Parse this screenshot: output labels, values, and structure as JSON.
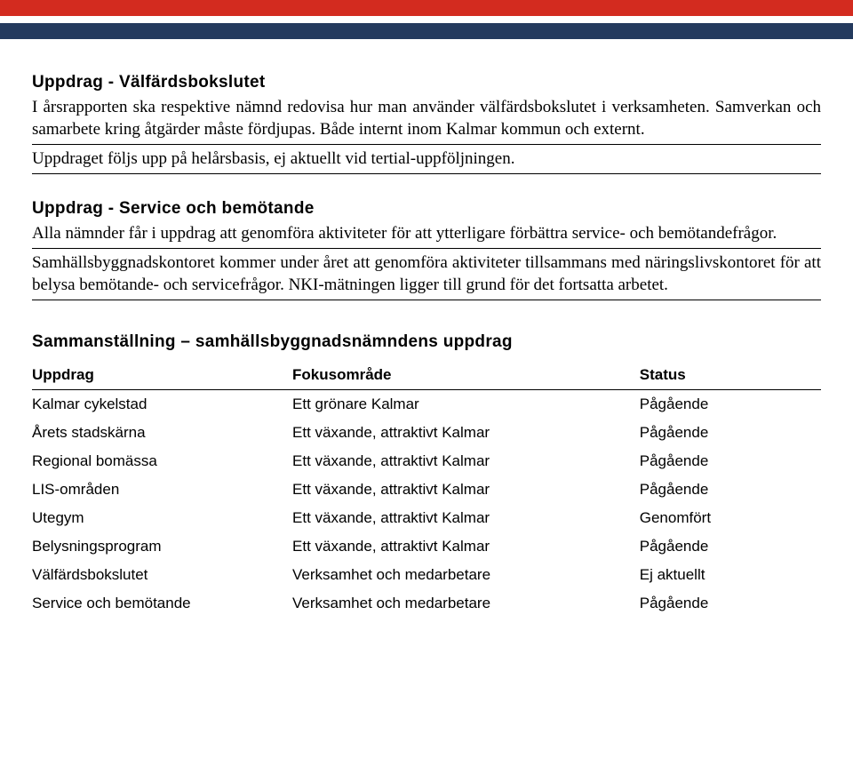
{
  "bars": {
    "red": "#d32b1f",
    "navy": "#243a5e"
  },
  "section1": {
    "title": "Uppdrag - Välfärdsbokslutet",
    "para": "I årsrapporten ska respektive nämnd redovisa hur man använder välfärdsbokslutet i verksamheten. Samverkan och samarbete kring åtgärder måste fördjupas. Både internt inom Kalmar kommun och externt.",
    "note": "Uppdraget följs upp på helårsbasis, ej aktuellt vid tertial-uppföljningen."
  },
  "section2": {
    "title": "Uppdrag - Service och bemötande",
    "para": "Alla nämnder får i uppdrag att genomföra aktiviteter för att ytterligare förbättra service- och bemötandefrågor.",
    "note": "Samhällsbyggnadskontoret kommer under året att genomföra aktiviteter tillsammans med näringslivskontoret för att belysa bemötande- och servicefrågor. NKI-mätningen ligger till grund för det fortsatta arbetet."
  },
  "summary": {
    "title": "Sammanställning – samhällsbyggnadsnämndens uppdrag",
    "headers": {
      "uppdrag": "Uppdrag",
      "fokus": "Fokusområde",
      "status": "Status"
    },
    "rows": [
      {
        "uppdrag": "Kalmar cykelstad",
        "fokus": "Ett grönare Kalmar",
        "status": "Pågående"
      },
      {
        "uppdrag": "Årets stadskärna",
        "fokus": "Ett växande, attraktivt Kalmar",
        "status": "Pågående"
      },
      {
        "uppdrag": "Regional bomässa",
        "fokus": "Ett växande, attraktivt Kalmar",
        "status": "Pågående"
      },
      {
        "uppdrag": "LIS-områden",
        "fokus": "Ett växande, attraktivt Kalmar",
        "status": "Pågående"
      },
      {
        "uppdrag": "Utegym",
        "fokus": "Ett växande, attraktivt Kalmar",
        "status": "Genomfört"
      },
      {
        "uppdrag": "Belysningsprogram",
        "fokus": "Ett växande, attraktivt Kalmar",
        "status": "Pågående"
      },
      {
        "uppdrag": "Välfärdsbokslutet",
        "fokus": "Verksamhet och medarbetare",
        "status": "Ej aktuellt"
      },
      {
        "uppdrag": "Service och bemötande",
        "fokus": "Verksamhet och medarbetare",
        "status": "Pågående"
      }
    ]
  }
}
